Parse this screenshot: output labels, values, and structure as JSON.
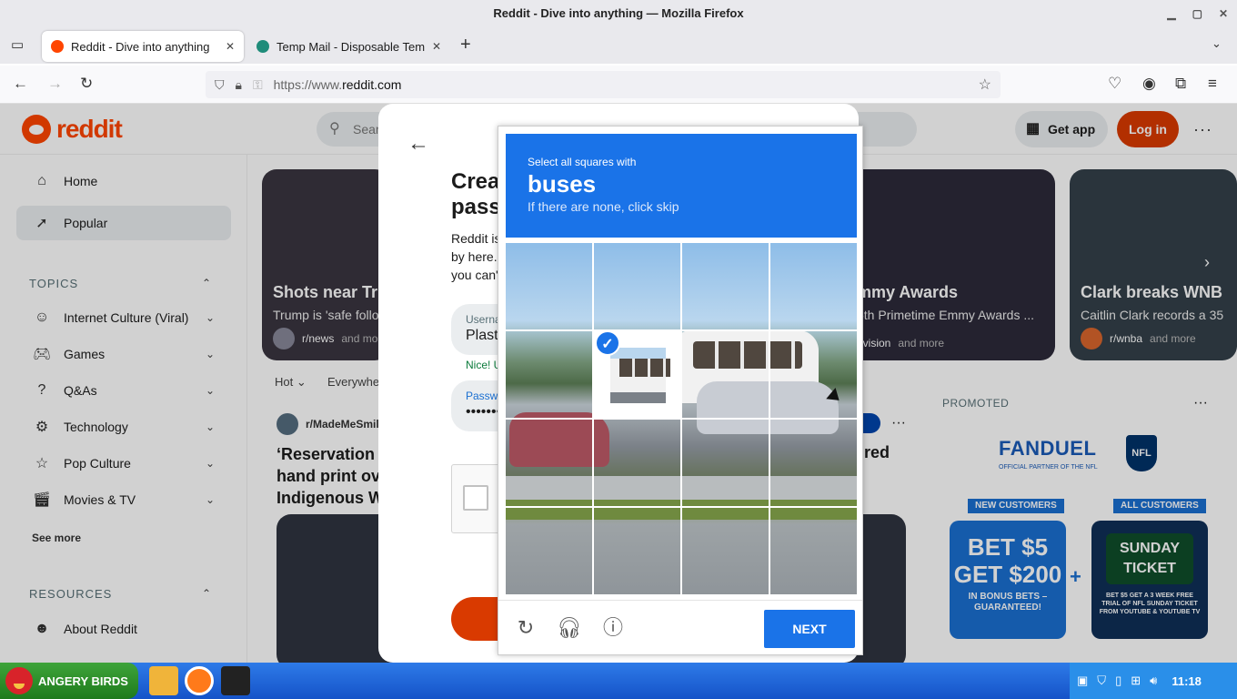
{
  "window": {
    "title": "Reddit - Dive into anything — Mozilla Firefox"
  },
  "tabs": [
    {
      "label": "Reddit - Dive into anything",
      "active": true
    },
    {
      "label": "Temp Mail - Disposable Tem",
      "active": false
    }
  ],
  "url": {
    "prefix": "https://www.",
    "domain": "reddit.com"
  },
  "reddit": {
    "logo_text": "reddit",
    "search_placeholder": "Search",
    "get_app": "Get app",
    "login": "Log in",
    "nav": [
      {
        "label": "Home",
        "icon": "home-icon"
      },
      {
        "label": "Popular",
        "icon": "popular-icon"
      }
    ],
    "topics_header": "TOPICS",
    "topics": [
      {
        "label": "Internet Culture (Viral)",
        "icon": "smile-icon"
      },
      {
        "label": "Games",
        "icon": "gamepad-icon"
      },
      {
        "label": "Q&As",
        "icon": "question-icon"
      },
      {
        "label": "Technology",
        "icon": "chip-icon"
      },
      {
        "label": "Pop Culture",
        "icon": "star-icon"
      },
      {
        "label": "Movies & TV",
        "icon": "clapper-icon"
      }
    ],
    "see_more": "See more",
    "resources_header": "RESOURCES",
    "resources": [
      {
        "label": "About Reddit",
        "icon": "snoo-icon"
      }
    ],
    "cards": [
      {
        "title": "Shots near Tr",
        "desc": "Trump is 'safe follo",
        "sub": "r/news",
        "more": "and more"
      },
      {
        "title": "mmy Awards",
        "desc": "5th Primetime Emmy Awards ...",
        "sub": "evision",
        "more": "and more"
      },
      {
        "title": "Clark breaks WNB",
        "desc": "Caitlin Clark records a 35",
        "sub": "r/wnba",
        "more": "and more"
      }
    ],
    "feed_filters": {
      "sort": "Hot",
      "scope": "Everywhe"
    },
    "post": {
      "subreddit": "r/MadeMeSmil",
      "title": "‘Reservation hand print ov Indigenous W",
      "title_right": "red"
    },
    "promoted": "PROMOTED",
    "ad": {
      "brand": "FANDUEL",
      "brand_sub": "OFFICIAL PARTNER OF THE NFL",
      "nfl": "NFL",
      "pill_left": "NEW CUSTOMERS",
      "pill_right": "ALL CUSTOMERS",
      "box_left_big": "BET $5 GET $200",
      "box_left_small": "IN BONUS BETS –GUARANTEED!",
      "box_right_big": "SUNDAY TICKET",
      "box_right_small": "BET $5 GET A 3 WEEK FREE TRIAL OF NFL SUNDAY TICKET FROM YOUTUBE & YOUTUBE TV",
      "colors": {
        "blue": "#1a5bb8",
        "green": "#0f4d2a"
      }
    }
  },
  "signup": {
    "heading": "Crea pass",
    "desc": "Reddit is by here. you can'",
    "username_label": "Userna",
    "username_value": "Plast",
    "nice": "Nice! U",
    "password_label": "Passw",
    "password_value": "•••••••"
  },
  "captcha": {
    "line1": "Select all squares with",
    "target": "buses",
    "line3": "If there are none, click skip",
    "next": "NEXT",
    "accent": "#1a73e8"
  },
  "taskbar": {
    "start_label": "ANGERY BIRDS",
    "clock": "11:18"
  }
}
